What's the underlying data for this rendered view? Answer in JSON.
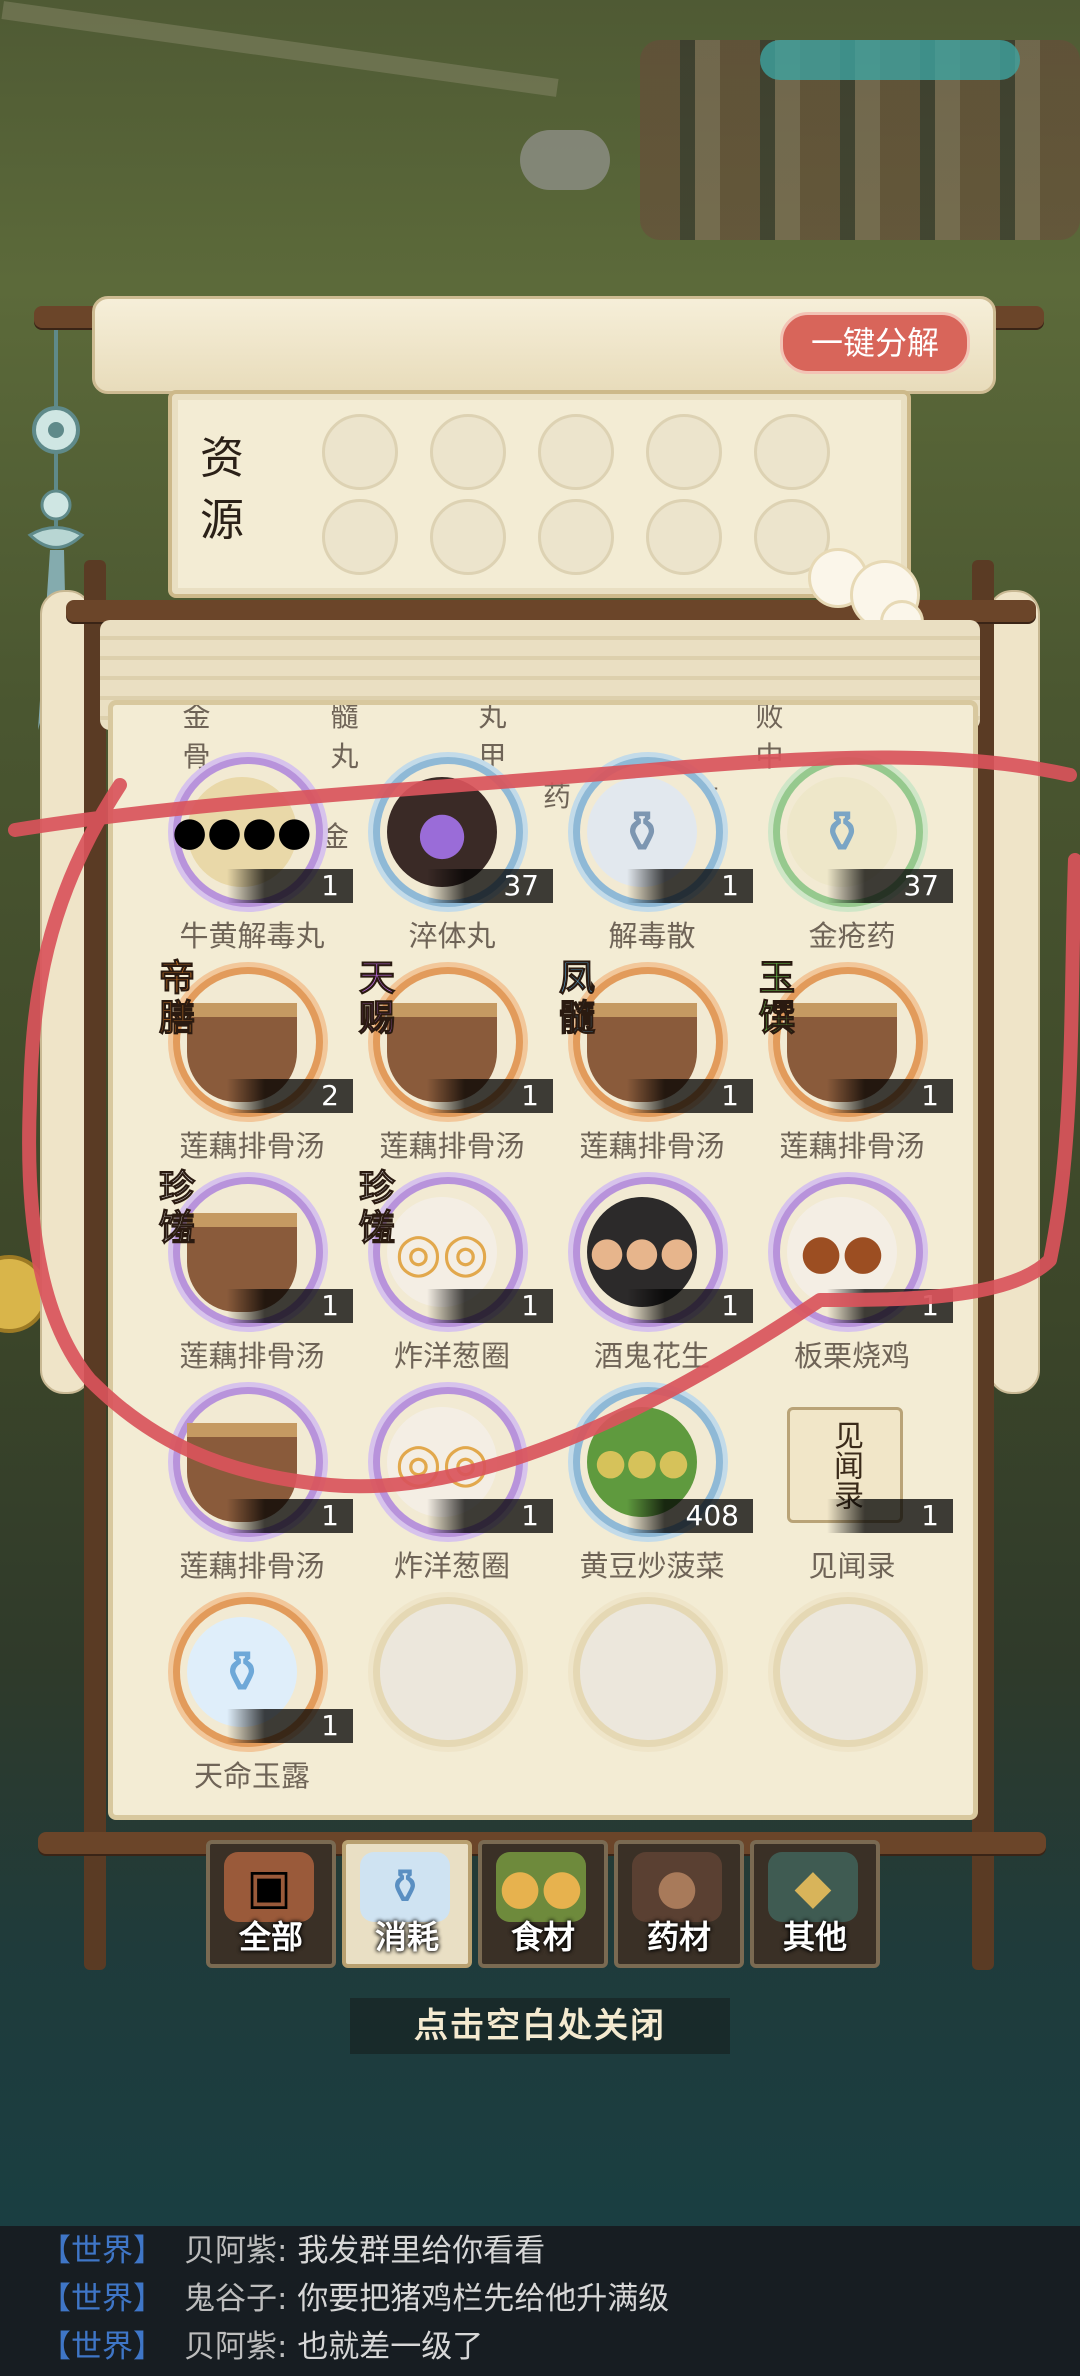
{
  "header": {
    "decompose_button": "一键分解"
  },
  "resources": {
    "title": "资源"
  },
  "partial_top_row": "金髓丸 败骨丸甲 中品阳药方 金心散",
  "items": [
    {
      "name": "牛黄解毒丸",
      "count": "1",
      "quality": "purple",
      "icon": "pill-icon",
      "tag": ""
    },
    {
      "name": "淬体丸",
      "count": "37",
      "quality": "blue",
      "icon": "chest-icon",
      "tag": ""
    },
    {
      "name": "解毒散",
      "count": "1",
      "quality": "blue",
      "icon": "vase-icon",
      "tag": ""
    },
    {
      "name": "金疮药",
      "count": "37",
      "quality": "green",
      "icon": "powder-icon",
      "tag": ""
    },
    {
      "name": "莲藕排骨汤",
      "count": "2",
      "quality": "orange",
      "icon": "soup-pot-icon",
      "tag": "帝膳",
      "tag_color": "#f08a2a"
    },
    {
      "name": "莲藕排骨汤",
      "count": "1",
      "quality": "orange",
      "icon": "soup-pot-icon",
      "tag": "天赐",
      "tag_color": "#b86ae0"
    },
    {
      "name": "莲藕排骨汤",
      "count": "1",
      "quality": "orange",
      "icon": "soup-pot-icon",
      "tag": "凤髓",
      "tag_color": "#57a7d8"
    },
    {
      "name": "莲藕排骨汤",
      "count": "1",
      "quality": "orange",
      "icon": "soup-pot-icon",
      "tag": "玉馔",
      "tag_color": "#67c44e"
    },
    {
      "name": "莲藕排骨汤",
      "count": "1",
      "quality": "purple",
      "icon": "soup-pot-icon",
      "tag": "珍馐",
      "tag_color": "#ffffff"
    },
    {
      "name": "炸洋葱圈",
      "count": "1",
      "quality": "purple",
      "icon": "onion-rings-icon",
      "tag": "珍馐",
      "tag_color": "#ffffff"
    },
    {
      "name": "酒鬼花生",
      "count": "1",
      "quality": "purple",
      "icon": "peanuts-icon",
      "tag": ""
    },
    {
      "name": "板栗烧鸡",
      "count": "1",
      "quality": "purple",
      "icon": "chicken-icon",
      "tag": ""
    },
    {
      "name": "莲藕排骨汤",
      "count": "1",
      "quality": "purple",
      "icon": "soup-pot-icon",
      "tag": ""
    },
    {
      "name": "炸洋葱圈",
      "count": "1",
      "quality": "purple",
      "icon": "onion-rings-icon",
      "tag": ""
    },
    {
      "name": "黄豆炒菠菜",
      "count": "408",
      "quality": "blue",
      "icon": "greens-icon",
      "tag": ""
    },
    {
      "name": "见闻录",
      "count": "1",
      "quality": "orange",
      "icon": "book-icon",
      "tag": "",
      "book_label": "见闻录"
    },
    {
      "name": "天命玉露",
      "count": "1",
      "quality": "orange",
      "icon": "dew-bottle-icon",
      "tag": ""
    },
    {
      "name": "",
      "count": "",
      "quality": "empty",
      "icon": "empty-slot-icon",
      "tag": ""
    },
    {
      "name": "",
      "count": "",
      "quality": "empty",
      "icon": "empty-slot-icon",
      "tag": ""
    },
    {
      "name": "",
      "count": "",
      "quality": "empty",
      "icon": "empty-slot-icon",
      "tag": ""
    }
  ],
  "tabs": [
    {
      "label": "全部",
      "icon": "treasure-chest-icon",
      "active": false
    },
    {
      "label": "消耗",
      "icon": "potion-icon",
      "active": true
    },
    {
      "label": "食材",
      "icon": "vegetables-icon",
      "active": false
    },
    {
      "label": "药材",
      "icon": "herb-pot-icon",
      "active": false
    },
    {
      "label": "其他",
      "icon": "jar-icon",
      "active": false
    }
  ],
  "close_hint": "点击空白处关闭",
  "chat": [
    {
      "channel": "【世界】",
      "sender": "贝阿紫:",
      "message": "我发群里给你看看"
    },
    {
      "channel": "【世界】",
      "sender": "鬼谷子:",
      "message": "你要把猪鸡栏先给他升满级"
    },
    {
      "channel": "【世界】",
      "sender": "贝阿紫:",
      "message": "也就差一级了"
    }
  ],
  "colors": {
    "accent_red": "#d8655a",
    "annotation_red": "#d9545b",
    "chat_channel": "#3f76c7"
  }
}
